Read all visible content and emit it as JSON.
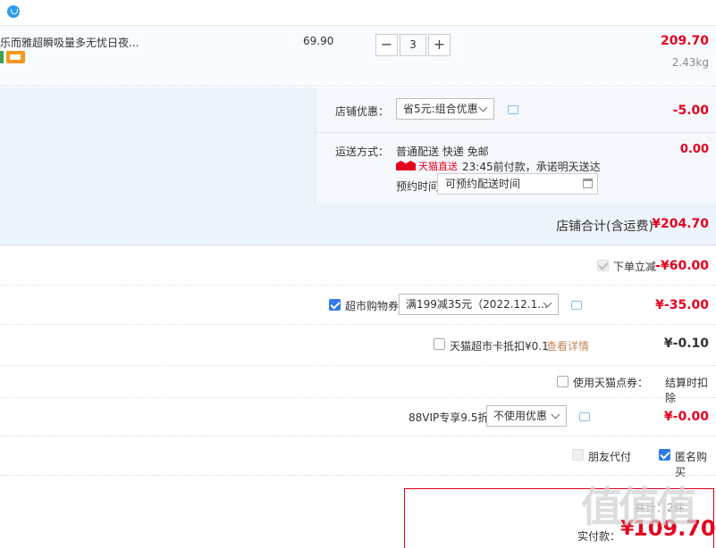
{
  "item": {
    "name": "乐而雅超瞬吸量多无忧日夜...",
    "unit_price": "69.90",
    "quantity": "3",
    "minus": "−",
    "plus": "+",
    "subtotal": "209.70",
    "weight": "2.43kg"
  },
  "shop": {
    "discount_label": "店铺优惠：",
    "discount_select": "省5元:组合优惠",
    "discount_amount": "-5.00",
    "shipping_label": "运送方式：",
    "shipping_method": "普通配送 快递 免邮",
    "shipping_amount": "0.00",
    "tmall_badge": "天猫直送",
    "delivery_promise": "23:45前付款，承诺明天送达",
    "reserve_label": "预约时间",
    "reserve_placeholder": "可预约配送时间",
    "total_label": "店铺合计(含运费)",
    "total_value": "¥204.70"
  },
  "discounts": {
    "instant_label": "下单立减",
    "instant_value": "-¥60.00",
    "coupon_label": "超市购物券",
    "coupon_select": "满199减35元（2022.12.1...",
    "coupon_value": "¥-35.00",
    "card_label": "天猫超市卡抵扣¥0.1",
    "card_link": "查看详情",
    "card_value": "¥-0.10",
    "points_label": "使用天猫点券：",
    "points_note": "结算时扣除",
    "vip_label": "88VIP专享9.5折",
    "vip_select": "不使用优惠",
    "vip_value": "¥-0.00",
    "friend_pay": "朋友代付",
    "anonymous": "匿名购买"
  },
  "payment": {
    "label": "实付款：",
    "value": "109.70",
    "hint": "共计：2件"
  },
  "watermark": "值值值",
  "colors": {
    "accent_red": "#e4001f",
    "checkbox_blue": "#2f7be8",
    "link_tan": "#c08a5a"
  }
}
